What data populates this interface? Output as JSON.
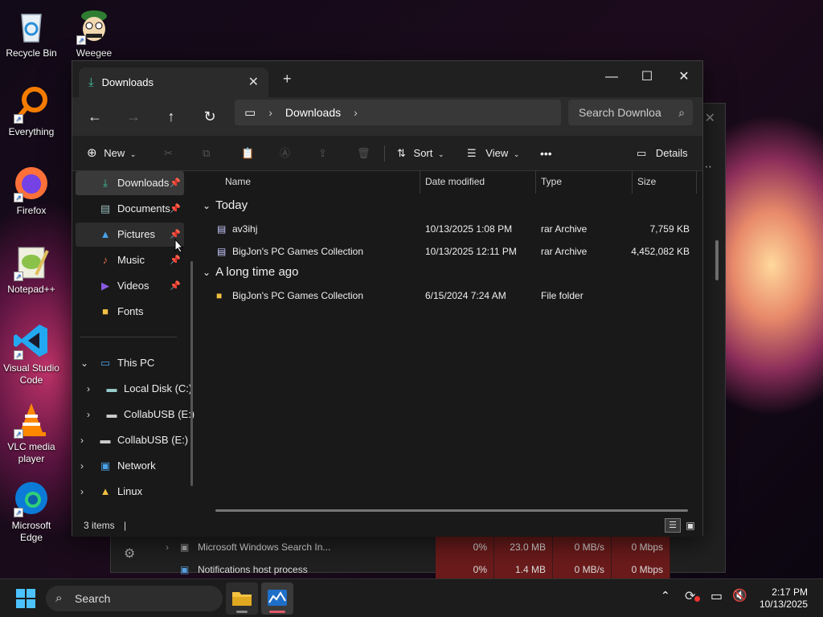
{
  "desktop": {
    "icons": [
      {
        "label": "Recycle Bin",
        "icon": "recycle-bin-icon"
      },
      {
        "label": "Weegee",
        "icon": "weegee-icon"
      },
      {
        "label": "Everything",
        "icon": "everything-search-icon"
      },
      {
        "label": "Firefox",
        "icon": "firefox-icon"
      },
      {
        "label": "Notepad++",
        "icon": "notepad-plus-plus-icon"
      },
      {
        "label": "Visual Studio Code",
        "icon": "vscode-icon"
      },
      {
        "label": "VLC media player",
        "icon": "vlc-icon"
      },
      {
        "label": "Microsoft Edge",
        "icon": "edge-icon"
      }
    ]
  },
  "taskmgr": {
    "rows": [
      {
        "name": "Microsoft Windows Search In...",
        "cpu": "0%",
        "mem": "23.0 MB",
        "disk": "0 MB/s",
        "net": "0 Mbps"
      },
      {
        "name": "Notifications host process",
        "cpu": "0%",
        "mem": "1.4 MB",
        "disk": "0 MB/s",
        "net": "0 Mbps"
      }
    ]
  },
  "explorer": {
    "tab_title": "Downloads",
    "window_controls": {
      "minimize": "—",
      "maximize": "☐",
      "close": "✕"
    },
    "address": {
      "crumb": "Downloads"
    },
    "search_placeholder": "Search Downloa",
    "toolbar": {
      "new": "New",
      "sort": "Sort",
      "view": "View",
      "more": "•••",
      "details": "Details"
    },
    "sidebar": {
      "pinned": [
        {
          "label": "Downloads",
          "icon": "download-icon"
        },
        {
          "label": "Documents",
          "icon": "documents-icon"
        },
        {
          "label": "Pictures",
          "icon": "pictures-icon"
        },
        {
          "label": "Music",
          "icon": "music-icon"
        },
        {
          "label": "Videos",
          "icon": "videos-icon"
        },
        {
          "label": "Fonts",
          "icon": "folder-icon"
        }
      ],
      "tree": [
        {
          "label": "This PC",
          "icon": "computer-icon"
        },
        {
          "label": "Local Disk (C:)",
          "icon": "drive-icon"
        },
        {
          "label": "CollabUSB (E:)",
          "icon": "usb-drive-icon"
        },
        {
          "label": "CollabUSB (E:)",
          "icon": "usb-drive-icon"
        },
        {
          "label": "Network",
          "icon": "network-icon"
        },
        {
          "label": "Linux",
          "icon": "linux-icon"
        }
      ]
    },
    "columns": {
      "name": "Name",
      "date": "Date modified",
      "type": "Type",
      "size": "Size"
    },
    "groups": [
      {
        "title": "Today",
        "files": [
          {
            "name": "av3ihj",
            "date": "10/13/2025 1:08 PM",
            "type": "rar Archive",
            "size": "7,759 KB"
          },
          {
            "name": "BigJon's PC Games Collection",
            "date": "10/13/2025 12:11 PM",
            "type": "rar Archive",
            "size": "4,452,082 KB"
          }
        ]
      },
      {
        "title": "A long time ago",
        "files": [
          {
            "name": "BigJon's PC Games Collection",
            "date": "6/15/2024 7:24 AM",
            "type": "File folder",
            "size": ""
          }
        ]
      }
    ],
    "status": "3 items"
  },
  "taskbar": {
    "search": "Search",
    "time": "2:17 PM",
    "date": "10/13/2025"
  }
}
